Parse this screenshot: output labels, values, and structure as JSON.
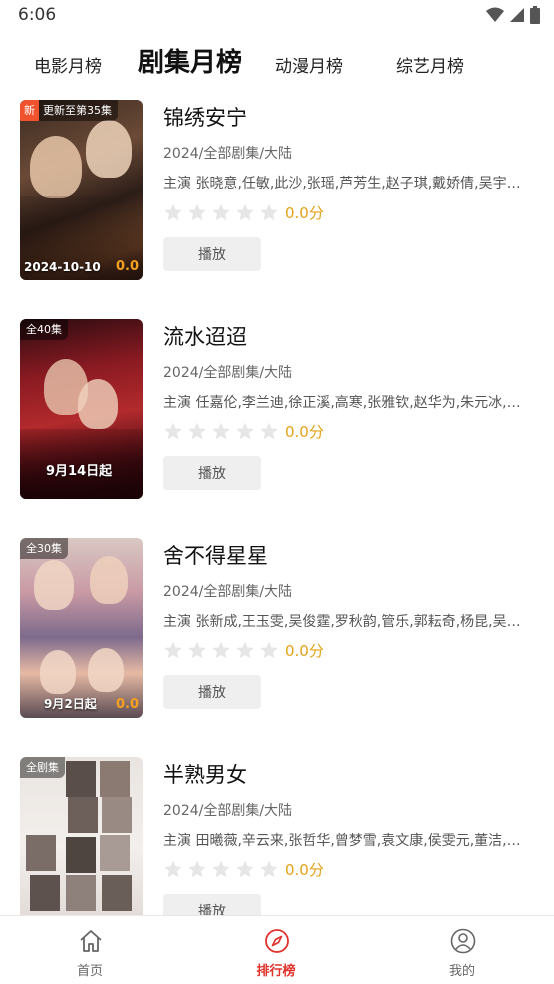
{
  "status_bar": {
    "time": "6:06"
  },
  "tabs": [
    {
      "label": "电影月榜",
      "active": false
    },
    {
      "label": "剧集月榜",
      "active": true
    },
    {
      "label": "动漫月榜",
      "active": false
    },
    {
      "label": "综艺月榜",
      "active": false
    }
  ],
  "items": [
    {
      "title": "锦绣安宁",
      "meta": "2024/全部剧集/大陆",
      "cast": "主演 张晓意,任敏,此沙,张瑶,芦芳生,赵子琪,戴娇倩,吴宇…",
      "rating_stars": 0,
      "score": "0.0分",
      "play_label": "播放",
      "poster": {
        "new_badge": "新",
        "badge": "更新至第35集",
        "bottom_text": "2024-10-10",
        "corner_score": "0.0"
      }
    },
    {
      "title": "流水迢迢",
      "meta": "2024/全部剧集/大陆",
      "cast": "主演 任嘉伦,李兰迪,徐正溪,高寒,张雅钦,赵华为,朱元冰,…",
      "rating_stars": 0,
      "score": "0.0分",
      "play_label": "播放",
      "poster": {
        "badge": "全40集",
        "bottom_text": "9月14日起",
        "corner_score": ""
      }
    },
    {
      "title": "舍不得星星",
      "meta": "2024/全部剧集/大陆",
      "cast": "主演 张新成,王玉雯,吴俊霆,罗秋韵,管乐,郭耘奇,杨昆,吴…",
      "rating_stars": 0,
      "score": "0.0分",
      "play_label": "播放",
      "poster": {
        "badge": "全30集",
        "bottom_text": "9月2日起",
        "corner_score": "0.0"
      }
    },
    {
      "title": "半熟男女",
      "meta": "2024/全部剧集/大陆",
      "cast": "主演 田曦薇,辛云来,张哲华,曾梦雪,袁文康,侯雯元,董洁,…",
      "rating_stars": 0,
      "score": "0.0分",
      "play_label": "播放",
      "poster": {
        "badge": "全剧集",
        "bottom_text": "",
        "corner_score": ""
      }
    }
  ],
  "bottom_nav": [
    {
      "label": "首页",
      "icon": "home-icon",
      "active": false
    },
    {
      "label": "排行榜",
      "icon": "compass-icon",
      "active": true
    },
    {
      "label": "我的",
      "icon": "user-icon",
      "active": false
    }
  ],
  "colors": {
    "accent": "#e0312a",
    "score": "#e4a218",
    "star_empty": "#e6e6e6"
  }
}
